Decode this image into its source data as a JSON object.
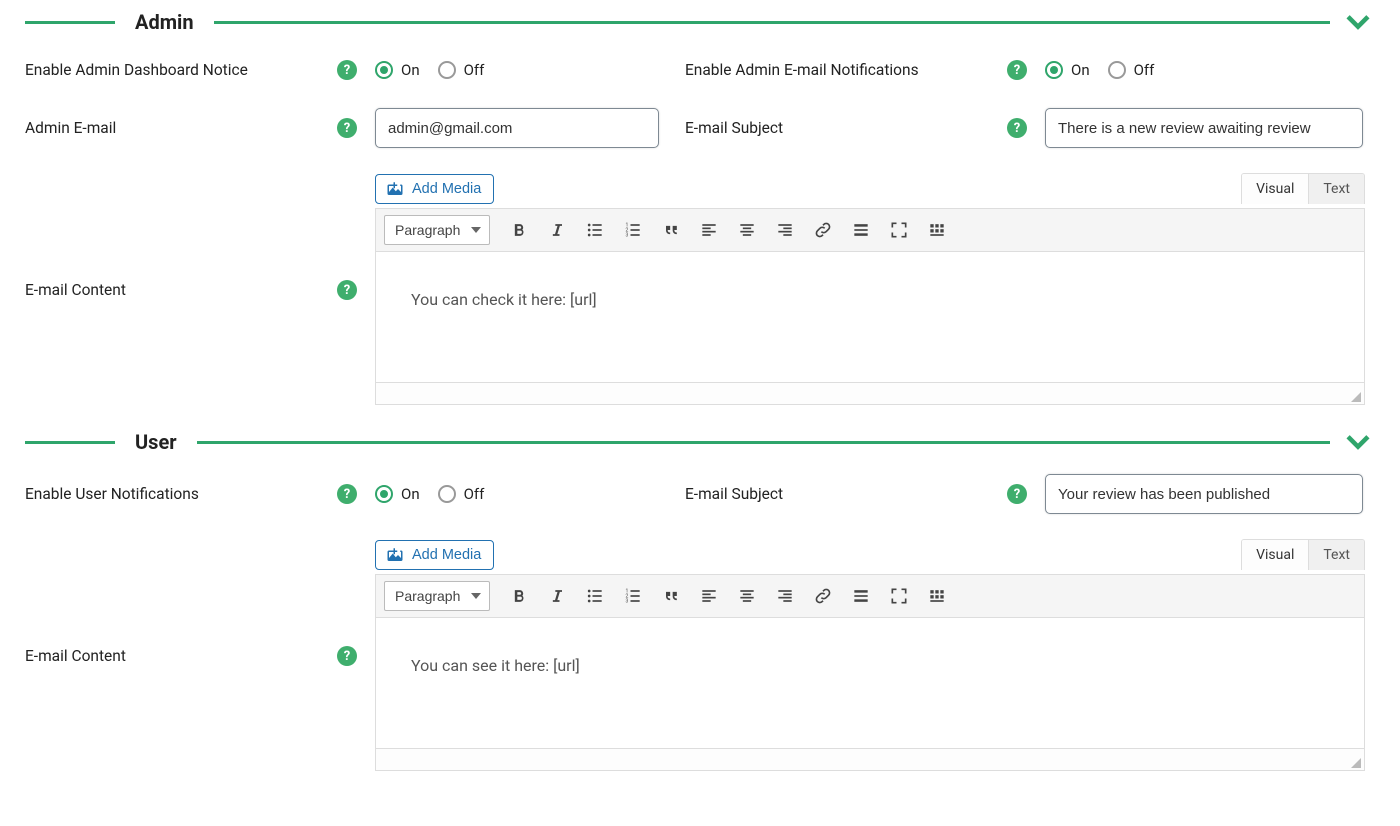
{
  "common": {
    "radio_on": "On",
    "radio_off": "Off",
    "add_media": "Add Media",
    "tab_visual": "Visual",
    "tab_text": "Text",
    "format": "Paragraph"
  },
  "admin": {
    "heading": "Admin",
    "dashboard_notice_label": "Enable Admin Dashboard Notice",
    "dashboard_notice_value": "On",
    "email_notif_label": "Enable Admin E-mail Notifications",
    "email_notif_value": "On",
    "email_label": "Admin E-mail",
    "email_value": "admin@gmail.com",
    "subject_label": "E-mail Subject",
    "subject_value": "There is a new review awaiting review",
    "content_label": "E-mail Content",
    "content_body": "You can check it here: [url]"
  },
  "user": {
    "heading": "User",
    "enable_label": "Enable User Notifications",
    "enable_value": "On",
    "subject_label": "E-mail Subject",
    "subject_value": "Your review has been published",
    "content_label": "E-mail Content",
    "content_body": "You can see it here: [url]"
  },
  "toolbar_items": [
    "bold",
    "italic",
    "bulleted-list",
    "numbered-list",
    "blockquote",
    "align-left",
    "align-center",
    "align-right",
    "link",
    "read-more",
    "fullscreen",
    "toolbar-toggle"
  ]
}
